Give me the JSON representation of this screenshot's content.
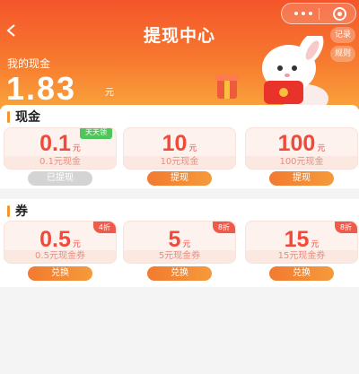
{
  "header": {
    "title": "提现中心",
    "records_label": "记录",
    "rules_label": "规则",
    "my_cash_label": "我的现金",
    "balance": "1.83",
    "balance_unit": "元"
  },
  "cash_section": {
    "title": "现金",
    "items": [
      {
        "value": "0.1",
        "unit": "元",
        "tag": "天天领",
        "desc": "0.1元现金",
        "button": "已提现"
      },
      {
        "value": "10",
        "unit": "元",
        "desc": "10元现金",
        "button": "提现"
      },
      {
        "value": "100",
        "unit": "元",
        "desc": "100元现金",
        "button": "提现"
      }
    ]
  },
  "coupon_section": {
    "title": "券",
    "items": [
      {
        "value": "0.5",
        "unit": "元",
        "tag": "4折",
        "desc": "0.5元现金券",
        "button": "兑换"
      },
      {
        "value": "5",
        "unit": "元",
        "tag": "8折",
        "desc": "5元现金券",
        "button": "兑换"
      },
      {
        "value": "15",
        "unit": "元",
        "tag": "8折",
        "desc": "15元现金券",
        "button": "兑换"
      }
    ]
  },
  "colors": {
    "accent": "#f4552a",
    "value_red": "#ef4a3a",
    "button_orange": "#f27a31",
    "done_gray": "#d4d4d4"
  }
}
